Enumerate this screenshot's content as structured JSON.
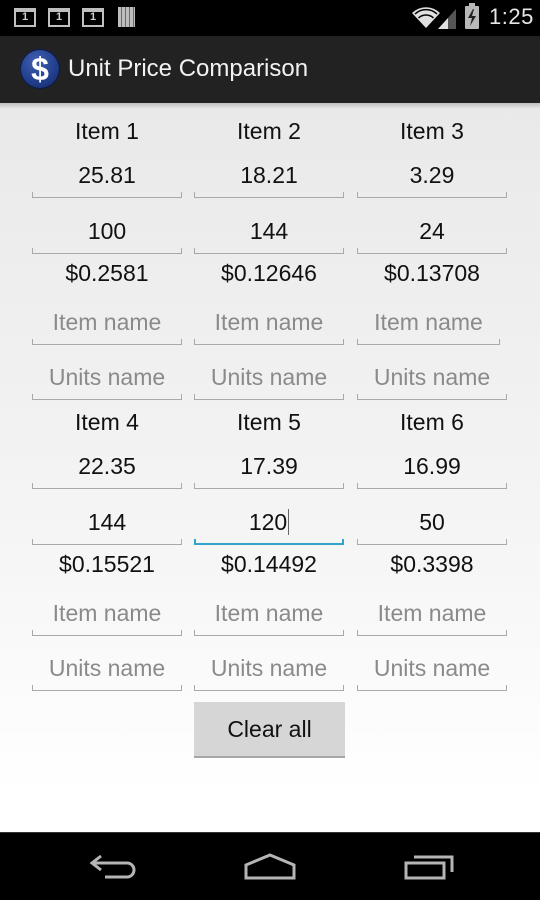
{
  "status_bar": {
    "notifications": [
      "1",
      "1",
      "1"
    ],
    "time": "1:25"
  },
  "action_bar": {
    "icon_glyph": "$",
    "title": "Unit Price Comparison"
  },
  "items": [
    {
      "label": "Item 1",
      "price": "25.81",
      "units": "100",
      "unit_price": "$0.2581",
      "item_name": "",
      "units_name": ""
    },
    {
      "label": "Item 2",
      "price": "18.21",
      "units": "144",
      "unit_price": "$0.12646",
      "item_name": "",
      "units_name": ""
    },
    {
      "label": "Item 3",
      "price": "3.29",
      "units": "24",
      "unit_price": "$0.13708",
      "item_name": "",
      "units_name": ""
    },
    {
      "label": "Item 4",
      "price": "22.35",
      "units": "144",
      "unit_price": "$0.15521",
      "item_name": "",
      "units_name": ""
    },
    {
      "label": "Item 5",
      "price": "17.39",
      "units": "120",
      "unit_price": "$0.14492",
      "item_name": "",
      "units_name": "",
      "focused_field": "units"
    },
    {
      "label": "Item 6",
      "price": "16.99",
      "units": "50",
      "unit_price": "$0.3398",
      "item_name": "",
      "units_name": ""
    }
  ],
  "placeholders": {
    "item_name": "Item name",
    "units_name": "Units name"
  },
  "clear_button": "Clear all",
  "colors": {
    "focus_accent": "#33a3cc",
    "action_bar": "#222222"
  }
}
